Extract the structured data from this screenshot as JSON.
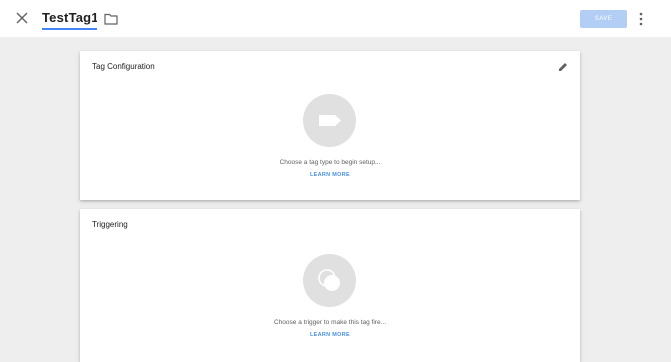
{
  "header": {
    "tag_name": "TestTag1",
    "save_label": "SAVE"
  },
  "tag_configuration": {
    "title": "Tag Configuration",
    "hint": "Choose a tag type to begin setup...",
    "learn_more": "LEARN MORE"
  },
  "triggering": {
    "title": "Triggering",
    "hint": "Choose a trigger to make this tag fire...",
    "learn_more": "LEARN MORE"
  },
  "icons": {
    "close": "close-icon",
    "folder": "folder-icon",
    "more": "more-vertical-icon",
    "edit": "pencil-icon",
    "tag": "tag-icon",
    "trigger": "trigger-icon"
  },
  "colors": {
    "accent": "#4285f4",
    "link": "#4a90e2",
    "save_disabled": "#b3cef5",
    "background": "#eeeeee"
  }
}
